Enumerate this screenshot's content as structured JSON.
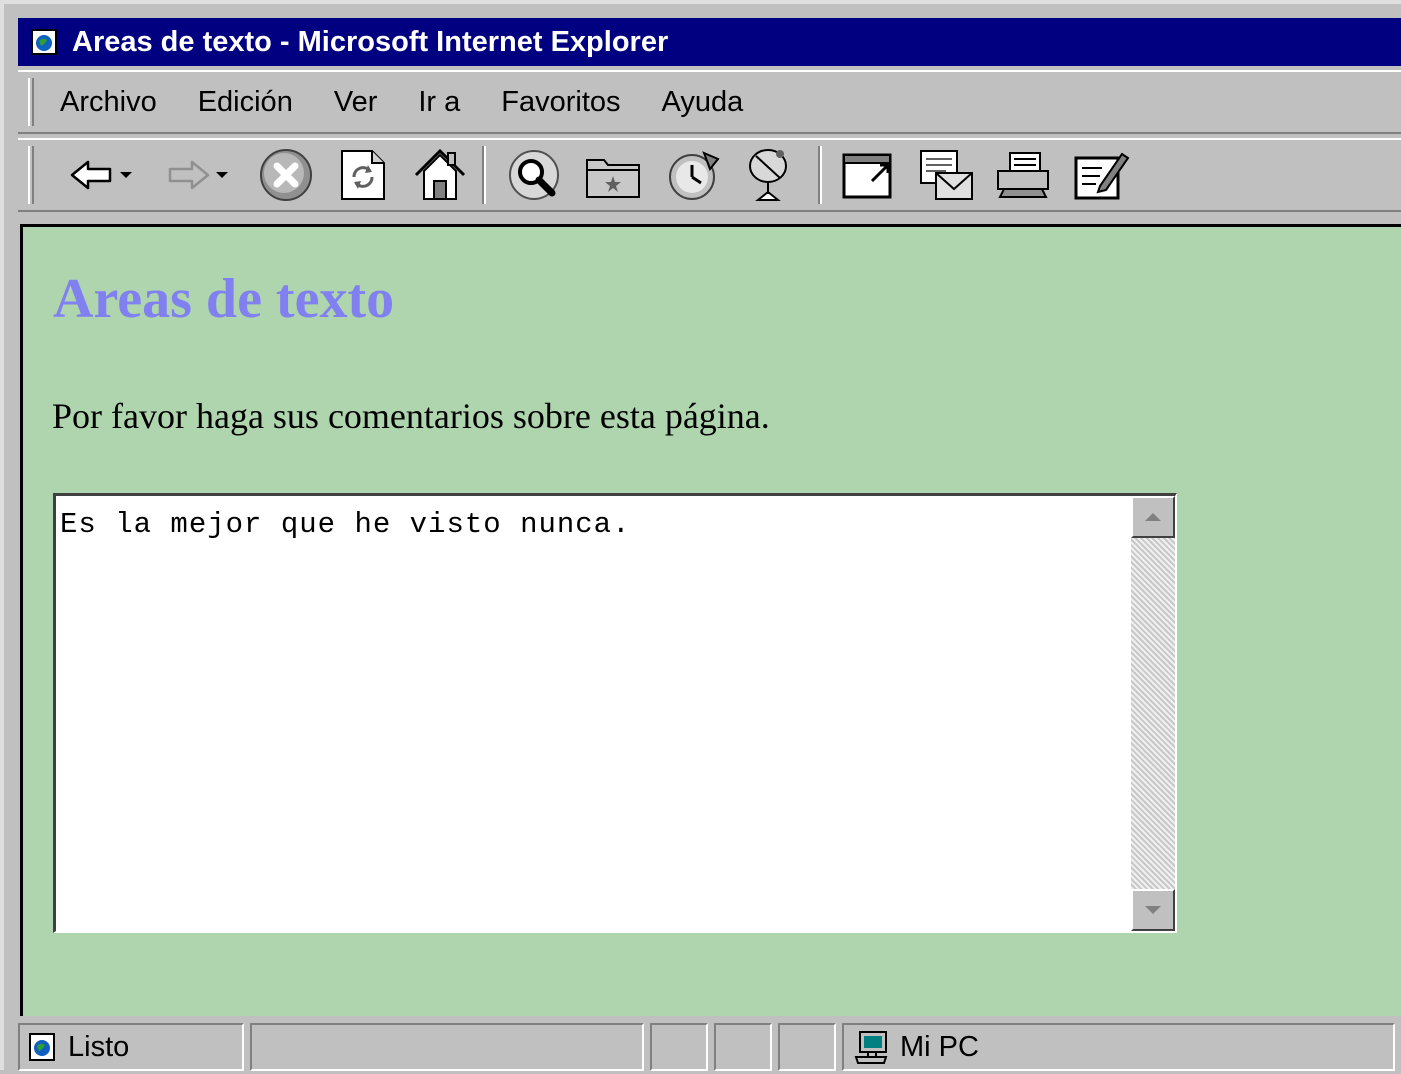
{
  "window": {
    "title": "Areas de texto - Microsoft Internet Explorer"
  },
  "menu": {
    "items": [
      "Archivo",
      "Edición",
      "Ver",
      "Ir a",
      "Favoritos",
      "Ayuda"
    ]
  },
  "toolbar": {
    "buttons": [
      "back",
      "forward",
      "stop",
      "refresh",
      "home",
      "search",
      "favorites",
      "history",
      "channels",
      "fullscreen",
      "mail",
      "print",
      "edit"
    ]
  },
  "page": {
    "heading": "Areas de texto",
    "intro": "Por favor haga sus comentarios sobre esta página.",
    "textarea_value": "Es la mejor que he visto nunca."
  },
  "statusbar": {
    "status_text": "Listo",
    "zone_text": "Mi PC"
  },
  "colors": {
    "titlebar": "#000080",
    "page_background": "#aed5ae",
    "heading": "#8080f0",
    "chrome": "#c0c0c0"
  }
}
